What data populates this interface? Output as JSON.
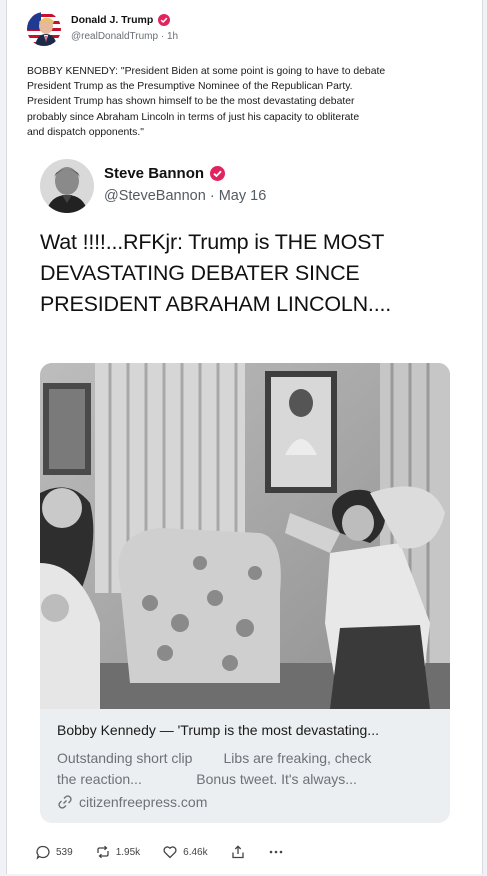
{
  "post": {
    "author_name": "Donald J. Trump",
    "handle": "@realDonaldTrump",
    "separator": "·",
    "time": "1h",
    "body": "BOBBY KENNEDY: \"President Biden at some point is going to have to debate\nPresident Trump as the Presumptive Nominee of the Republican Party.\nPresident Trump has shown himself to be the most devastating debater\nprobably since Abraham Lincoln in terms of just his capacity to obliterate\nand dispatch opponents.\""
  },
  "quote": {
    "author_name": "Steve Bannon",
    "handle": "@SteveBannon",
    "separator": "·",
    "date": "May 16",
    "text": "Wat !!!!...RFKjr: Trump is THE MOST DEVASTATING DEBATER SINCE PRESIDENT ABRAHAM LINCOLN....",
    "link": {
      "title": "Bobby Kennedy — 'Trump is the most devastating...",
      "description": "Outstanding short clip        Libs are freaking, check\nthe reaction...              Bonus tweet. It's always...",
      "domain": "citizenfreepress.com"
    }
  },
  "actions": {
    "replies": "539",
    "reposts": "1.95k",
    "likes": "6.46k"
  },
  "colors": {
    "verified_badge": "#e0245e",
    "muted_text": "#6d7278",
    "link_card_bg": "#eceff1"
  },
  "icons": [
    "verified-badge-icon",
    "link-icon",
    "reply-icon",
    "repost-icon",
    "like-icon",
    "share-icon",
    "more-icon"
  ]
}
